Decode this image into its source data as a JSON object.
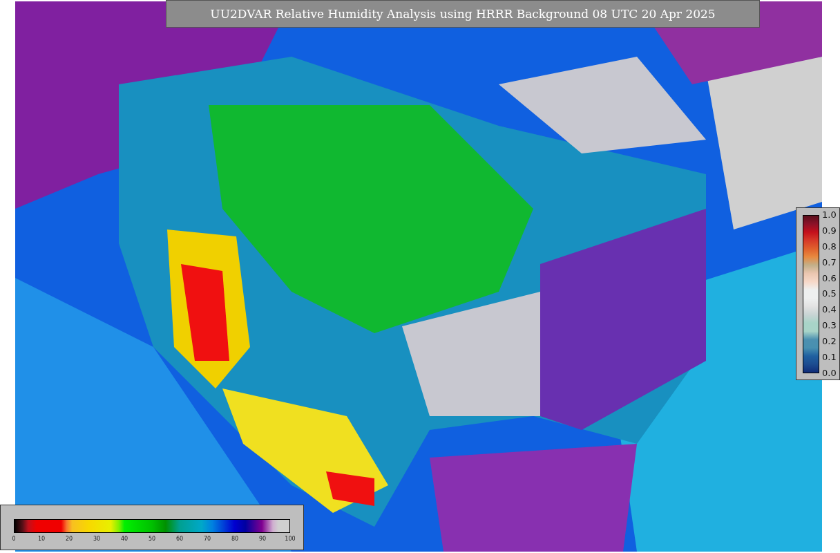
{
  "title": "UU2DVAR Relative Humidity Analysis using HRRR Background 08 UTC 20 Apr 2025",
  "colorbar_right": {
    "ticks": [
      "1.0",
      "0.9",
      "0.8",
      "0.7",
      "0.6",
      "0.5",
      "0.4",
      "0.3",
      "0.2",
      "0.1",
      "0.0"
    ]
  },
  "colorbar_bottom": {
    "ticks": [
      "0",
      "10",
      "20",
      "30",
      "40",
      "50",
      "60",
      "70",
      "80",
      "90",
      "100"
    ]
  }
}
